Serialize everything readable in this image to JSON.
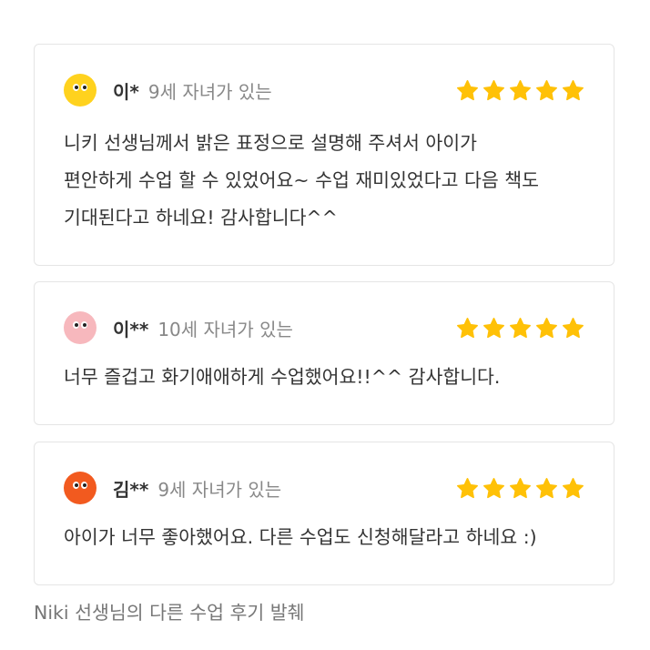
{
  "colors": {
    "star": "#ffc107",
    "avatar_yellow": "#ffd21e",
    "avatar_pink": "#f7b8bd",
    "avatar_orange": "#f25a1f"
  },
  "reviews": [
    {
      "avatar_icon": "yellow-face-avatar",
      "name": "이*",
      "subtitle": "9세 자녀가 있는",
      "rating": 5,
      "lines": [
        "니키 선생님께서 밝은 표정으로 설명해 주셔서 아이가",
        "편안하게 수업 할 수 있었어요~ 수업 재미있었다고 다음 책도",
        "기대된다고 하네요! 감사합니다^^"
      ]
    },
    {
      "avatar_icon": "pink-face-avatar",
      "name": "이**",
      "subtitle": "10세 자녀가 있는",
      "rating": 5,
      "lines": [
        "너무 즐겁고 화기애애하게 수업했어요!!^^ 감사합니다."
      ]
    },
    {
      "avatar_icon": "orange-face-avatar",
      "name": "김**",
      "subtitle": "9세 자녀가 있는",
      "rating": 5,
      "lines": [
        "아이가 너무 좋아했어요. 다른 수업도 신청해달라고 하네요 :)"
      ]
    }
  ],
  "footer": "Niki 선생님의  다른 수업 후기 발췌"
}
